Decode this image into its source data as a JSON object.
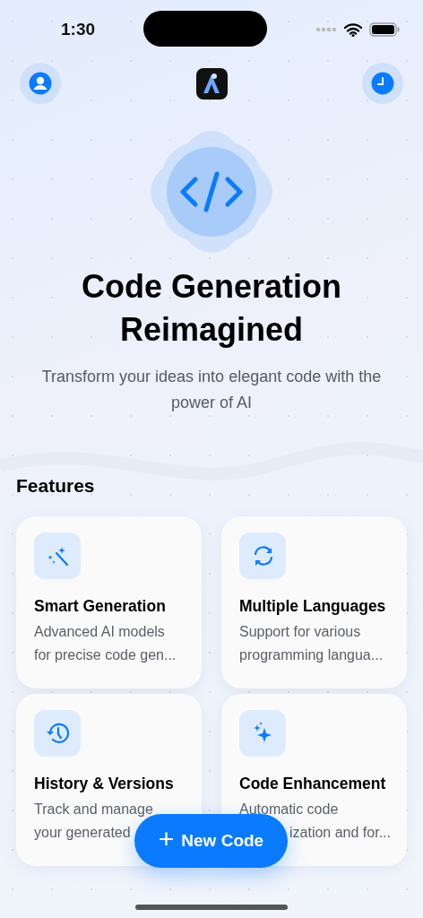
{
  "status_bar": {
    "time": "1:30"
  },
  "hero": {
    "title": "Code Generation Reimagined",
    "subtitle": "Transform your ideas into elegant code with the power of AI"
  },
  "features": {
    "heading": "Features",
    "items": [
      {
        "kind": "wand",
        "title": "Smart Generation",
        "lines": [
          "Advanced AI models",
          "for precise code gen..."
        ]
      },
      {
        "kind": "sync",
        "title": "Multiple Languages",
        "lines": [
          "Support for various",
          "programming langua..."
        ]
      },
      {
        "kind": "history",
        "title": "History & Versions",
        "lines": [
          "Track and manage",
          "your generated"
        ]
      },
      {
        "kind": "sparkle",
        "title": "Code Enhancement",
        "lines": [
          "Automatic code",
          "ization and for..."
        ]
      }
    ]
  },
  "fab": {
    "icon": "+",
    "label": "New Code"
  }
}
